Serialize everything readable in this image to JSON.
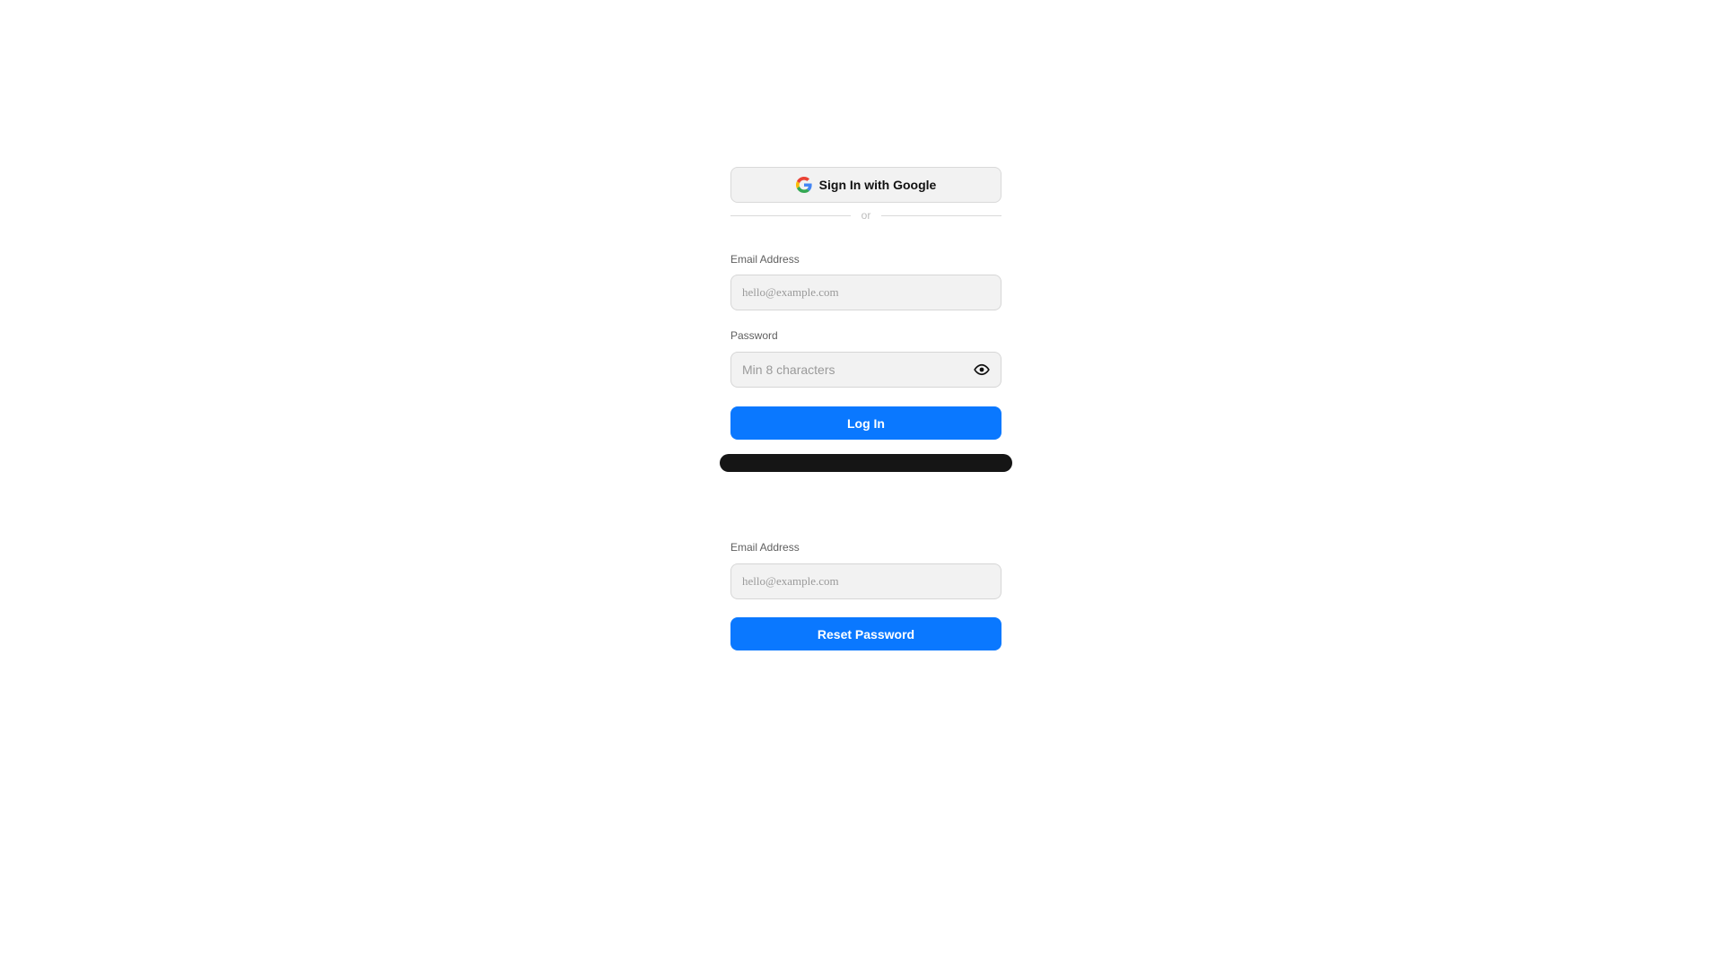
{
  "login": {
    "google_button_label": "Sign In with Google",
    "divider_text": "or",
    "email_label": "Email Address",
    "email_placeholder": "hello@example.com",
    "email_value": "",
    "password_label": "Password",
    "password_placeholder": "Min 8 characters",
    "password_value": "",
    "login_button_label": "Log In"
  },
  "reset": {
    "email_label": "Email Address",
    "email_placeholder": "hello@example.com",
    "email_value": "",
    "reset_button_label": "Reset Password"
  },
  "colors": {
    "primary": "#0a78ff",
    "dark_bar": "#151515",
    "field_bg": "#f2f2f2"
  },
  "icons": {
    "google": "google-logo-icon",
    "eye": "eye-icon"
  }
}
